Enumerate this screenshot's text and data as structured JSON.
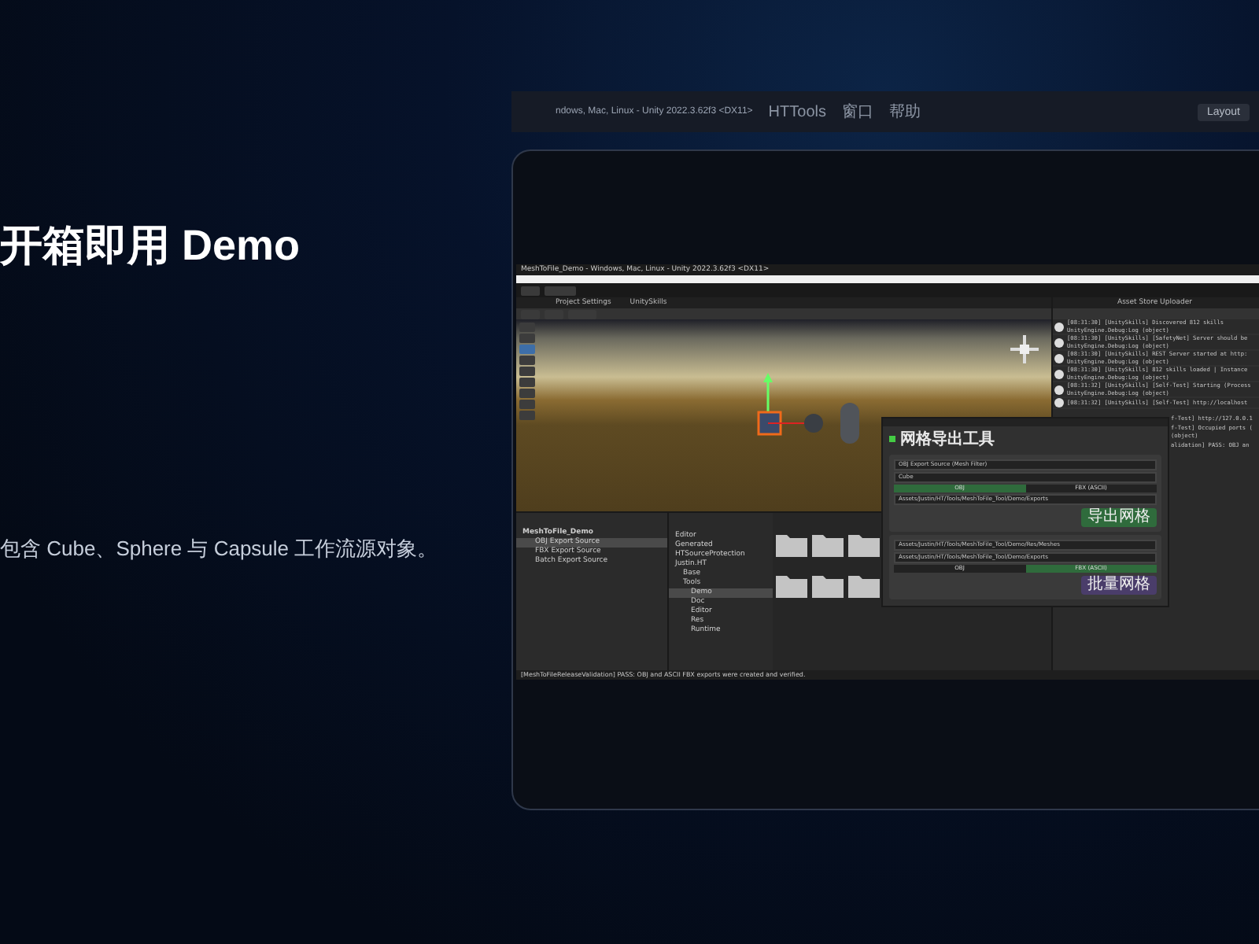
{
  "slide": {
    "title": "开箱即用 Demo",
    "subtitle": "包含 Cube、Sphere 与 Capsule 工作流源对象。"
  },
  "background_window": {
    "title": "ndows, Mac, Linux - Unity 2022.3.62f3 <DX11>",
    "menu": [
      "HTTools",
      "窗口",
      "帮助"
    ],
    "layout_button": "Layout"
  },
  "editor": {
    "title": "MeshToFile_Demo - Windows, Mac, Linux - Unity 2022.3.62f3 <DX11>",
    "tabs": [
      "Project Settings",
      "UnitySkills"
    ],
    "hierarchy": {
      "root": "MeshToFile_Demo",
      "items": [
        {
          "label": "OBJ Export Source",
          "selected": true
        },
        {
          "label": "FBX Export Source",
          "selected": false
        },
        {
          "label": "Batch Export Source",
          "selected": false
        }
      ]
    },
    "project_tree": [
      {
        "label": "Editor",
        "selected": false
      },
      {
        "label": "Generated",
        "selected": false
      },
      {
        "label": "HTSourceProtection",
        "selected": false
      },
      {
        "label": "Justin.HT",
        "selected": false,
        "children": [
          {
            "label": "Base",
            "selected": false
          },
          {
            "label": "Tools",
            "selected": false,
            "children": [
              {
                "label": "Demo",
                "selected": true
              },
              {
                "label": "Doc",
                "selected": false
              },
              {
                "label": "Editor",
                "selected": false
              },
              {
                "label": "Res",
                "selected": false
              },
              {
                "label": "Runtime",
                "selected": false
              }
            ]
          }
        ]
      }
    ],
    "console": {
      "tab": "Asset Store Uploader",
      "entries": [
        {
          "text": "[08:31:30] [UnitySkills] Discovered 812 skills",
          "source": "UnityEngine.Debug:Log (object)"
        },
        {
          "text": "[08:31:30] [UnitySkills] [SafetyNet] Server should be",
          "source": "UnityEngine.Debug:Log (object)"
        },
        {
          "text": "[08:31:30] [UnitySkills] REST Server started at http:",
          "source": "UnityEngine.Debug:Log (object)"
        },
        {
          "text": "[08:31:30] [UnitySkills] 812 skills loaded | Instance",
          "source": "UnityEngine.Debug:Log (object)"
        },
        {
          "text": "[08:31:32] [UnitySkills] [Self-Test] Starting (Process",
          "source": "UnityEngine.Debug:Log (object)"
        },
        {
          "text": "[08:31:32] [UnitySkills] [Self-Test] http://localhost"
        }
      ],
      "cut_lines": [
        "f-Test] http://127.0.0.1",
        "f-Test] Occupied ports (",
        "(object)",
        "alidation] PASS: OBJ an"
      ]
    },
    "export_tool": {
      "title": "网格导出工具",
      "single": {
        "source": "OBJ Export Source (Mesh Filter)",
        "mesh_name": "Cube",
        "formats": [
          {
            "label": "OBJ",
            "selected": true
          },
          {
            "label": "FBX (ASCII)",
            "selected": false
          }
        ],
        "path": "Assets/Justin/HT/Tools/MeshToFile_Tool/Demo/Exports",
        "button": "导出网格"
      },
      "batch": {
        "paths": [
          "Assets/Justin/HT/Tools/MeshToFile_Tool/Demo/Res/Meshes",
          "Assets/Justin/HT/Tools/MeshToFile_Tool/Demo/Exports"
        ],
        "formats": [
          {
            "label": "OBJ",
            "selected": false
          },
          {
            "label": "FBX (ASCII)",
            "selected": true
          }
        ],
        "button": "批量网格"
      }
    },
    "status_bar": "[MeshToFileReleaseValidation] PASS: OBJ and ASCII FBX exports were created and verified."
  }
}
